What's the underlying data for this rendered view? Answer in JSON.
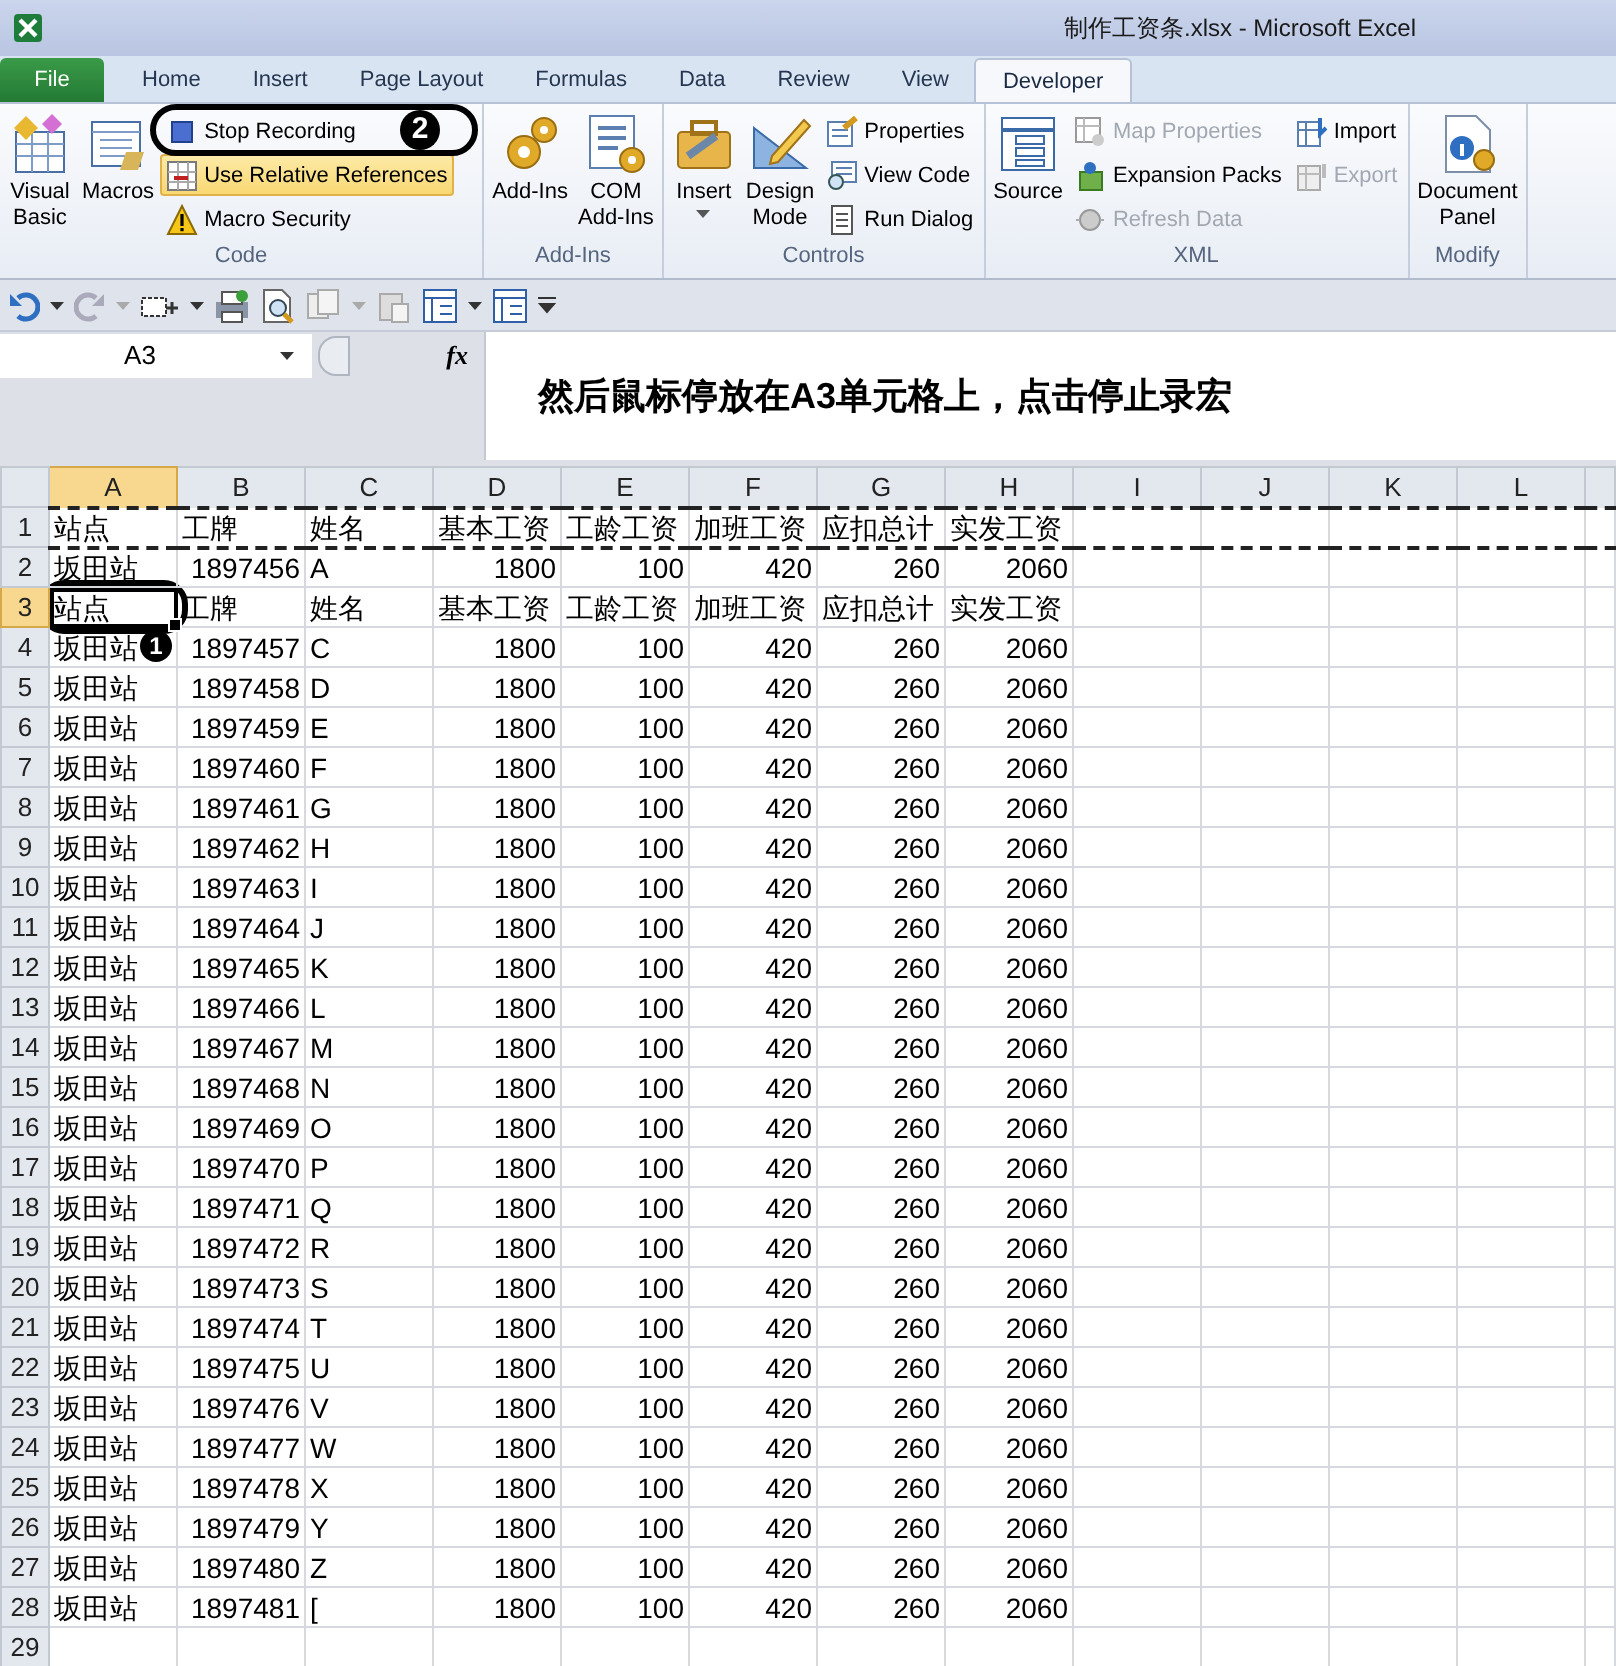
{
  "window": {
    "title": "制作工资条.xlsx  -  Microsoft Excel"
  },
  "tabs": [
    {
      "label": "File",
      "kind": "file",
      "selected": false
    },
    {
      "label": "Home",
      "kind": "tab",
      "selected": false
    },
    {
      "label": "Insert",
      "kind": "tab",
      "selected": false
    },
    {
      "label": "Page Layout",
      "kind": "tab",
      "selected": false
    },
    {
      "label": "Formulas",
      "kind": "tab",
      "selected": false
    },
    {
      "label": "Data",
      "kind": "tab",
      "selected": false
    },
    {
      "label": "Review",
      "kind": "tab",
      "selected": false
    },
    {
      "label": "View",
      "kind": "tab",
      "selected": false
    },
    {
      "label": "Developer",
      "kind": "tab",
      "selected": true
    }
  ],
  "ribbon_groups": [
    {
      "label": "Code",
      "controls": [
        {
          "kind": "large",
          "label": "Visual\nBasic",
          "dropdown": false
        },
        {
          "kind": "large",
          "label": "Macros",
          "dropdown": false
        },
        {
          "kind": "stack",
          "items": [
            {
              "label": "Stop Recording",
              "disabled": false,
              "selected": false
            },
            {
              "label": "Use Relative References",
              "disabled": false,
              "selected": true
            },
            {
              "label": "Macro Security",
              "disabled": false,
              "selected": false
            }
          ]
        }
      ]
    },
    {
      "label": "Add-Ins",
      "controls": [
        {
          "kind": "large",
          "label": "Add-Ins",
          "dropdown": false
        },
        {
          "kind": "large",
          "label": "COM\nAdd-Ins",
          "dropdown": false
        }
      ]
    },
    {
      "label": "Controls",
      "controls": [
        {
          "kind": "large",
          "label": "Insert",
          "dropdown": true
        },
        {
          "kind": "large",
          "label": "Design\nMode",
          "dropdown": false
        },
        {
          "kind": "stack",
          "items": [
            {
              "label": "Properties",
              "disabled": false,
              "selected": false
            },
            {
              "label": "View Code",
              "disabled": false,
              "selected": false
            },
            {
              "label": "Run Dialog",
              "disabled": false,
              "selected": false
            }
          ]
        }
      ]
    },
    {
      "label": "XML",
      "controls": [
        {
          "kind": "large",
          "label": "Source",
          "dropdown": false
        },
        {
          "kind": "stack",
          "items": [
            {
              "label": "Map Properties",
              "disabled": true,
              "selected": false
            },
            {
              "label": "Expansion Packs",
              "disabled": false,
              "selected": false
            },
            {
              "label": "Refresh Data",
              "disabled": true,
              "selected": false
            }
          ]
        },
        {
          "kind": "stack",
          "items": [
            {
              "label": "Import",
              "disabled": false,
              "selected": false
            },
            {
              "label": "Export",
              "disabled": true,
              "selected": false
            }
          ]
        }
      ]
    },
    {
      "label": "Modify",
      "controls": [
        {
          "kind": "large",
          "label": "Document\nPanel",
          "dropdown": false
        }
      ]
    }
  ],
  "formula_bar": {
    "name_box": "A3",
    "function_label": "fx",
    "content": "然后鼠标停放在A3单元格上，点击停止录宏"
  },
  "sheet": {
    "columns": [
      {
        "label": "A",
        "numeric": false,
        "selected": true
      },
      {
        "label": "B",
        "numeric": true,
        "selected": false
      },
      {
        "label": "C",
        "numeric": false,
        "selected": false
      },
      {
        "label": "D",
        "numeric": true,
        "selected": false
      },
      {
        "label": "E",
        "numeric": true,
        "selected": false
      },
      {
        "label": "F",
        "numeric": true,
        "selected": false
      },
      {
        "label": "G",
        "numeric": true,
        "selected": false
      },
      {
        "label": "H",
        "numeric": true,
        "selected": false
      },
      {
        "label": "I",
        "numeric": false,
        "selected": false
      },
      {
        "label": "J",
        "numeric": false,
        "selected": false
      },
      {
        "label": "K",
        "numeric": false,
        "selected": false
      },
      {
        "label": "L",
        "numeric": false,
        "selected": false
      }
    ],
    "rows": [
      {
        "number": "1",
        "kind": "header",
        "selected": false,
        "copied": true,
        "cells": [
          "站点",
          "工牌",
          "姓名",
          "基本工资",
          "工龄工资",
          "加班工资",
          "应扣总计",
          "实发工资"
        ]
      },
      {
        "number": "2",
        "kind": "data",
        "selected": false,
        "copied": false,
        "cells": [
          "坂田站",
          "1897456",
          "A",
          "1800",
          "100",
          "420",
          "260",
          "2060"
        ]
      },
      {
        "number": "3",
        "kind": "header",
        "selected": true,
        "copied": false,
        "cells": [
          "站点",
          "工牌",
          "姓名",
          "基本工资",
          "工龄工资",
          "加班工资",
          "应扣总计",
          "实发工资"
        ]
      },
      {
        "number": "4",
        "kind": "data",
        "selected": false,
        "copied": false,
        "cells": [
          "坂田站",
          "1897457",
          "C",
          "1800",
          "100",
          "420",
          "260",
          "2060"
        ]
      },
      {
        "number": "5",
        "kind": "data",
        "selected": false,
        "copied": false,
        "cells": [
          "坂田站",
          "1897458",
          "D",
          "1800",
          "100",
          "420",
          "260",
          "2060"
        ]
      },
      {
        "number": "6",
        "kind": "data",
        "selected": false,
        "copied": false,
        "cells": [
          "坂田站",
          "1897459",
          "E",
          "1800",
          "100",
          "420",
          "260",
          "2060"
        ]
      },
      {
        "number": "7",
        "kind": "data",
        "selected": false,
        "copied": false,
        "cells": [
          "坂田站",
          "1897460",
          "F",
          "1800",
          "100",
          "420",
          "260",
          "2060"
        ]
      },
      {
        "number": "8",
        "kind": "data",
        "selected": false,
        "copied": false,
        "cells": [
          "坂田站",
          "1897461",
          "G",
          "1800",
          "100",
          "420",
          "260",
          "2060"
        ]
      },
      {
        "number": "9",
        "kind": "data",
        "selected": false,
        "copied": false,
        "cells": [
          "坂田站",
          "1897462",
          "H",
          "1800",
          "100",
          "420",
          "260",
          "2060"
        ]
      },
      {
        "number": "10",
        "kind": "data",
        "selected": false,
        "copied": false,
        "cells": [
          "坂田站",
          "1897463",
          "I",
          "1800",
          "100",
          "420",
          "260",
          "2060"
        ]
      },
      {
        "number": "11",
        "kind": "data",
        "selected": false,
        "copied": false,
        "cells": [
          "坂田站",
          "1897464",
          "J",
          "1800",
          "100",
          "420",
          "260",
          "2060"
        ]
      },
      {
        "number": "12",
        "kind": "data",
        "selected": false,
        "copied": false,
        "cells": [
          "坂田站",
          "1897465",
          "K",
          "1800",
          "100",
          "420",
          "260",
          "2060"
        ]
      },
      {
        "number": "13",
        "kind": "data",
        "selected": false,
        "copied": false,
        "cells": [
          "坂田站",
          "1897466",
          "L",
          "1800",
          "100",
          "420",
          "260",
          "2060"
        ]
      },
      {
        "number": "14",
        "kind": "data",
        "selected": false,
        "copied": false,
        "cells": [
          "坂田站",
          "1897467",
          "M",
          "1800",
          "100",
          "420",
          "260",
          "2060"
        ]
      },
      {
        "number": "15",
        "kind": "data",
        "selected": false,
        "copied": false,
        "cells": [
          "坂田站",
          "1897468",
          "N",
          "1800",
          "100",
          "420",
          "260",
          "2060"
        ]
      },
      {
        "number": "16",
        "kind": "data",
        "selected": false,
        "copied": false,
        "cells": [
          "坂田站",
          "1897469",
          "O",
          "1800",
          "100",
          "420",
          "260",
          "2060"
        ]
      },
      {
        "number": "17",
        "kind": "data",
        "selected": false,
        "copied": false,
        "cells": [
          "坂田站",
          "1897470",
          "P",
          "1800",
          "100",
          "420",
          "260",
          "2060"
        ]
      },
      {
        "number": "18",
        "kind": "data",
        "selected": false,
        "copied": false,
        "cells": [
          "坂田站",
          "1897471",
          "Q",
          "1800",
          "100",
          "420",
          "260",
          "2060"
        ]
      },
      {
        "number": "19",
        "kind": "data",
        "selected": false,
        "copied": false,
        "cells": [
          "坂田站",
          "1897472",
          "R",
          "1800",
          "100",
          "420",
          "260",
          "2060"
        ]
      },
      {
        "number": "20",
        "kind": "data",
        "selected": false,
        "copied": false,
        "cells": [
          "坂田站",
          "1897473",
          "S",
          "1800",
          "100",
          "420",
          "260",
          "2060"
        ]
      },
      {
        "number": "21",
        "kind": "data",
        "selected": false,
        "copied": false,
        "cells": [
          "坂田站",
          "1897474",
          "T",
          "1800",
          "100",
          "420",
          "260",
          "2060"
        ]
      },
      {
        "number": "22",
        "kind": "data",
        "selected": false,
        "copied": false,
        "cells": [
          "坂田站",
          "1897475",
          "U",
          "1800",
          "100",
          "420",
          "260",
          "2060"
        ]
      },
      {
        "number": "23",
        "kind": "data",
        "selected": false,
        "copied": false,
        "cells": [
          "坂田站",
          "1897476",
          "V",
          "1800",
          "100",
          "420",
          "260",
          "2060"
        ]
      },
      {
        "number": "24",
        "kind": "data",
        "selected": false,
        "copied": false,
        "cells": [
          "坂田站",
          "1897477",
          "W",
          "1800",
          "100",
          "420",
          "260",
          "2060"
        ]
      },
      {
        "number": "25",
        "kind": "data",
        "selected": false,
        "copied": false,
        "cells": [
          "坂田站",
          "1897478",
          "X",
          "1800",
          "100",
          "420",
          "260",
          "2060"
        ]
      },
      {
        "number": "26",
        "kind": "data",
        "selected": false,
        "copied": false,
        "cells": [
          "坂田站",
          "1897479",
          "Y",
          "1800",
          "100",
          "420",
          "260",
          "2060"
        ]
      },
      {
        "number": "27",
        "kind": "data",
        "selected": false,
        "copied": false,
        "cells": [
          "坂田站",
          "1897480",
          "Z",
          "1800",
          "100",
          "420",
          "260",
          "2060"
        ]
      },
      {
        "number": "28",
        "kind": "data",
        "selected": false,
        "copied": false,
        "cells": [
          "坂田站",
          "1897481",
          "[",
          "1800",
          "100",
          "420",
          "260",
          "2060"
        ]
      },
      {
        "number": "29",
        "kind": "data",
        "selected": false,
        "copied": false
      }
    ]
  },
  "annotations": [
    {
      "number": "2"
    },
    {
      "number": "1"
    }
  ]
}
